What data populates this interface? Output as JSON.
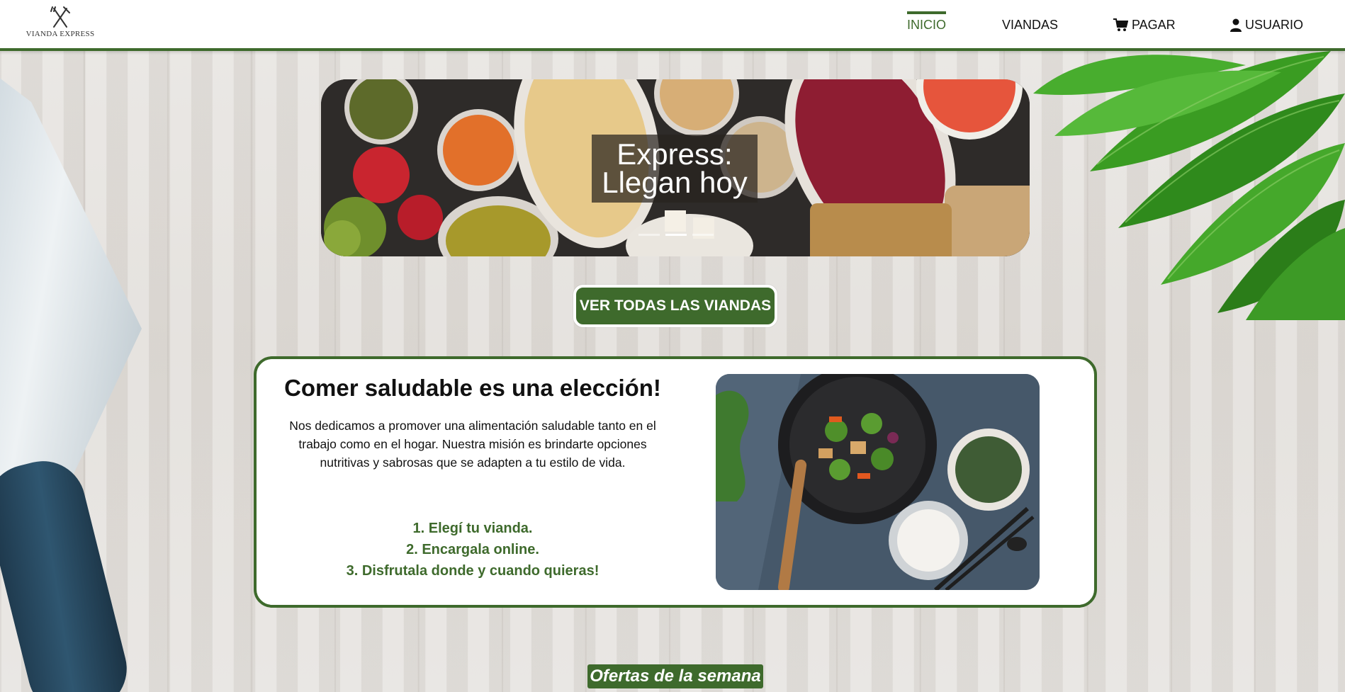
{
  "brand": {
    "name": "VIANDA EXPRESS",
    "icon": "fork-knife-icon"
  },
  "nav": {
    "items": [
      {
        "label": "INICIO",
        "icon": "",
        "active": true
      },
      {
        "label": "VIANDAS",
        "icon": "",
        "active": false
      },
      {
        "label": "PAGAR",
        "icon": "cart-icon",
        "active": false
      },
      {
        "label": "USUARIO",
        "icon": "user-icon",
        "active": false
      }
    ]
  },
  "hero": {
    "caption_line1": "Express:",
    "caption_line2": "Llegan hoy",
    "slides": 3,
    "active_slide": 2
  },
  "cta": {
    "label": "VER TODAS LAS VIANDAS"
  },
  "info": {
    "title": "Comer saludable es una elección!",
    "text": "Nos dedicamos a promover una alimentación saludable tanto en el trabajo como en el hogar. Nuestra misión es brindarte opciones nutritivas y sabrosas que se adapten a tu estilo de vida.",
    "steps": [
      "1. Elegí tu vianda.",
      "2. Encargala online.",
      "3. Disfrutala donde y cuando quieras!"
    ]
  },
  "section_label": "Ofertas de la semana",
  "colors": {
    "accent": "#3e6a2c",
    "header_bg": "#ffffff"
  }
}
